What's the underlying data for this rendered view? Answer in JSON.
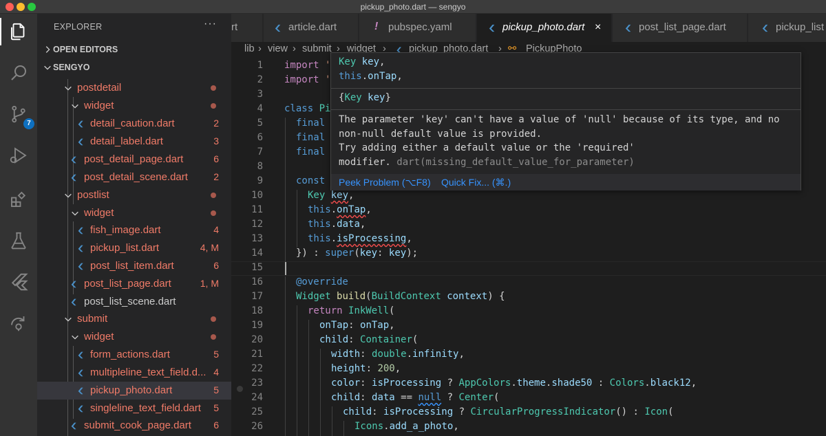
{
  "window": {
    "title": "pickup_photo.dart — sengyo"
  },
  "activity_bar": {
    "scm_badge": "7"
  },
  "explorer": {
    "title": "EXPLORER",
    "more": "···",
    "open_editors": "OPEN EDITORS",
    "workspace": "SENGYO",
    "tree": [
      {
        "name": "postdetail",
        "badge": "",
        "dot": true
      },
      {
        "name": "widget",
        "badge": "",
        "dot": true
      },
      {
        "name": "detail_caution.dart",
        "badge": "2",
        "dot": false
      },
      {
        "name": "detail_label.dart",
        "badge": "3",
        "dot": false
      },
      {
        "name": "post_detail_page.dart",
        "badge": "6",
        "dot": false
      },
      {
        "name": "post_detail_scene.dart",
        "badge": "2",
        "dot": false
      },
      {
        "name": "postlist",
        "badge": "",
        "dot": true
      },
      {
        "name": "widget",
        "badge": "",
        "dot": true
      },
      {
        "name": "fish_image.dart",
        "badge": "4",
        "dot": false
      },
      {
        "name": "pickup_list.dart",
        "badge": "4, M",
        "dot": false
      },
      {
        "name": "post_list_item.dart",
        "badge": "6",
        "dot": false
      },
      {
        "name": "post_list_page.dart",
        "badge": "1, M",
        "dot": false
      },
      {
        "name": "post_list_scene.dart",
        "badge": "",
        "dot": false
      },
      {
        "name": "submit",
        "badge": "",
        "dot": true
      },
      {
        "name": "widget",
        "badge": "",
        "dot": true
      },
      {
        "name": "form_actions.dart",
        "badge": "5",
        "dot": false
      },
      {
        "name": "multipleline_text_field.d...",
        "badge": "4",
        "dot": false
      },
      {
        "name": "pickup_photo.dart",
        "badge": "5",
        "dot": false
      },
      {
        "name": "singleline_text_field.dart",
        "badge": "5",
        "dot": false
      },
      {
        "name": "submit_cook_page.dart",
        "badge": "6",
        "dot": false
      }
    ]
  },
  "tabs": [
    {
      "label": "rt",
      "icon": ""
    },
    {
      "label": "article.dart",
      "icon": "dart-icon"
    },
    {
      "label": "pubspec.yaml",
      "icon": "yaml-icon"
    },
    {
      "label": "pickup_photo.dart",
      "icon": "dart-icon",
      "active": true,
      "close": "×"
    },
    {
      "label": "post_list_page.dart",
      "icon": "dart-icon"
    },
    {
      "label": "pickup_list",
      "icon": "dart-icon"
    }
  ],
  "breadcrumb": [
    "lib",
    "view",
    "submit",
    "widget",
    "pickup_photo.dart",
    "PickupPhoto"
  ],
  "editor": {
    "line_numbers": [
      "1",
      "2",
      "3",
      "4",
      "5",
      "6",
      "7",
      "8",
      "9",
      "10",
      "11",
      "12",
      "13",
      "14",
      "15",
      "16",
      "17",
      "18",
      "19",
      "20",
      "21",
      "22",
      "23",
      "24",
      "25",
      "26"
    ],
    "lines": {
      "l1a": "import",
      "l1b": " '",
      "l2a": "import",
      "l2b": " '",
      "l4a": "class",
      "l4b": " Pi",
      "l5": "final",
      "l6": "final",
      "l7": "final",
      "l9": "const",
      "l10a": "Key",
      "l10b": "key",
      "l10c": ",",
      "l11a": "this",
      "l11b": ".",
      "l11c": "onTap",
      "l11d": ",",
      "l12a": "this",
      "l12b": ".",
      "l12c": "data",
      "l12d": ",",
      "l13a": "this",
      "l13b": ".",
      "l13c": "isProcessing",
      "l13d": ",",
      "l14a": "}) : ",
      "l14b": "super",
      "l14c": "(",
      "l14d": "key",
      "l14e": ": ",
      "l14f": "key",
      "l14g": ");",
      "l16": "@override",
      "l17a": "Widget",
      "l17b": " ",
      "l17c": "build",
      "l17d": "(",
      "l17e": "BuildContext",
      "l17f": " ",
      "l17g": "context",
      "l17h": ") {",
      "l18a": "return",
      "l18b": " ",
      "l18c": "InkWell",
      "l18d": "(",
      "l19a": "onTap",
      "l19b": ": ",
      "l19c": "onTap",
      "l19d": ",",
      "l20a": "child",
      "l20b": ": ",
      "l20c": "Container",
      "l20d": "(",
      "l21a": "width",
      "l21b": ": ",
      "l21c": "double",
      "l21d": ".",
      "l21e": "infinity",
      "l21f": ",",
      "l22a": "height",
      "l22b": ": ",
      "l22c": "200",
      "l22d": ",",
      "l23a": "color",
      "l23b": ": ",
      "l23c": "isProcessing",
      "l23d": " ? ",
      "l23e": "AppColors",
      "l23f": ".",
      "l23g": "theme",
      "l23h": ".",
      "l23i": "shade50",
      "l23j": " : ",
      "l23k": "Colors",
      "l23l": ".",
      "l23m": "black12",
      "l23n": ",",
      "l24a": "child",
      "l24b": ": ",
      "l24c": "data",
      "l24d": " == ",
      "l24e": "null",
      "l24f": " ? ",
      "l24g": "Center",
      "l24h": "(",
      "l25a": "child",
      "l25b": ": ",
      "l25c": "isProcessing",
      "l25d": " ? ",
      "l25e": "CircularProgressIndicator",
      "l25f": "() : ",
      "l25g": "Icon",
      "l25h": "(",
      "l26a": "Icons",
      "l26b": ".",
      "l26c": "add_a_photo",
      "l26d": ","
    }
  },
  "hover": {
    "sig1a": "Key",
    "sig1b": " ",
    "sig1c": "key",
    "sig1d": ",",
    "sig2a": "this",
    "sig2b": ".",
    "sig2c": "onTap",
    "sig2d": ",",
    "doc_a": "{",
    "doc_b": "Key",
    "doc_c": " ",
    "doc_d": "key",
    "doc_e": "}",
    "msg1": "The parameter 'key' can't have a value of 'null' because of its type, and no",
    "msg2": "non-null default value is provided.",
    "msg3": "Try adding either a default value or the 'required'",
    "msg4a": "modifier.",
    "msg4b": " dart(missing_default_value_for_parameter)",
    "peek": "Peek Problem (⌥F8)",
    "quickfix": "Quick Fix... (⌘.)"
  }
}
